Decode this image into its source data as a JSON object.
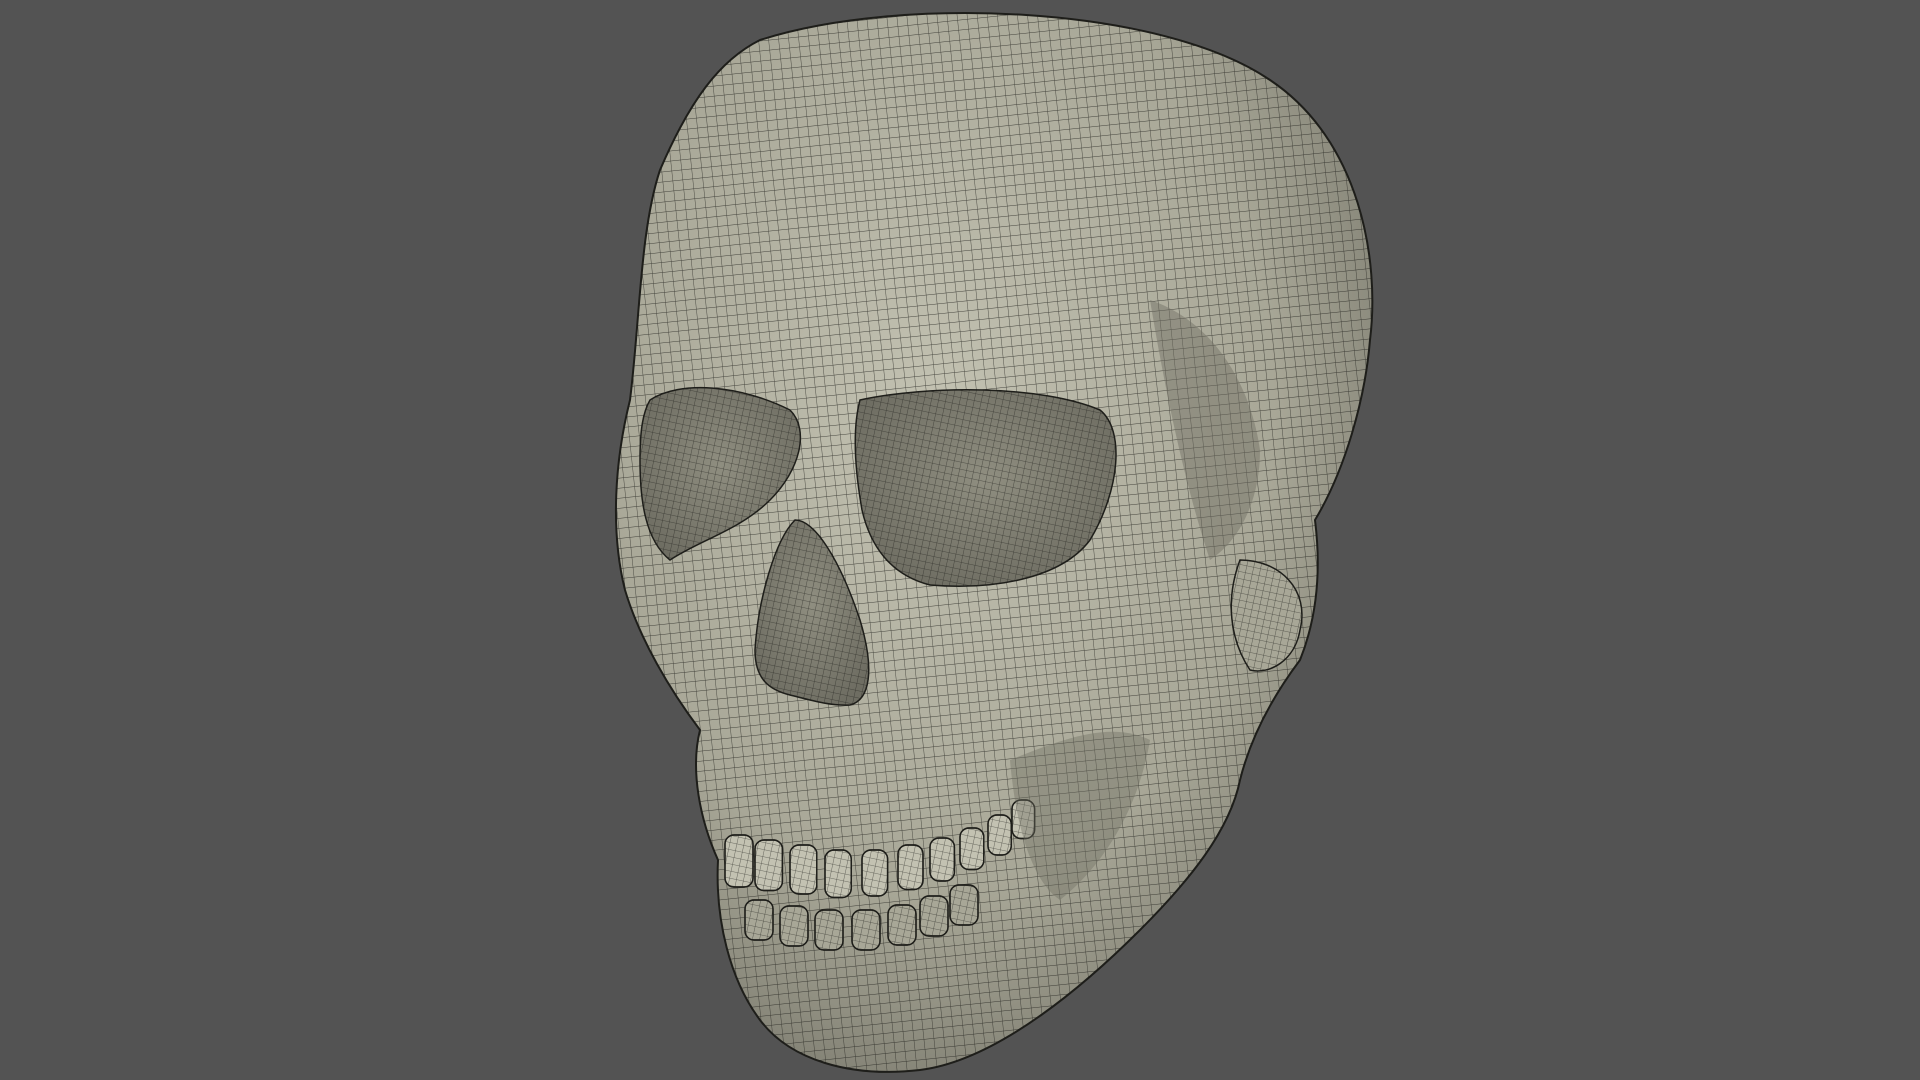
{
  "viewport": {
    "background_color": "#535353"
  },
  "model": {
    "subject": "skull-icon",
    "render_style": "wireframe-on-shaded",
    "surface_color": "#a8a797",
    "surface_light_color": "#c3c2b2",
    "surface_shadow_color": "#6e6d62",
    "wire_color": "#1e1e1a",
    "cavity_color": "#8f8e80"
  }
}
